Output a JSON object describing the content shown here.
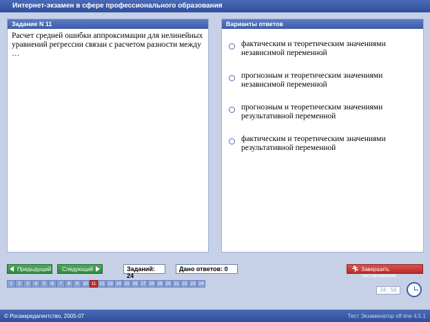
{
  "header": {
    "title": "Интернет-экзамен в сфере профессионального образования"
  },
  "question": {
    "heading": "Задание N 11",
    "text": "Расчет средней ошибки аппроксимации для нелинейных уравнений регрессии связан с расчетом разности между …"
  },
  "answers": {
    "heading": "Варианты ответов",
    "options": [
      "фактическим и теоретическим значениями независимой переменной",
      "прогнозным и теоретическим значениями независимой переменной",
      "прогнозным и теоретическим значениями результативной переменной",
      "фактическим и теоретическим значениями результативной переменной"
    ]
  },
  "nav": {
    "prev_label": "Предыдущий",
    "next_label": "Следующий"
  },
  "counters": {
    "tasks": "Заданий: 24",
    "answered": "Дано ответов: 0"
  },
  "finish_label": "Завершить тестирование",
  "pages": [
    "1",
    "2",
    "3",
    "4",
    "5",
    "6",
    "7",
    "8",
    "9",
    "10",
    "11",
    "12",
    "13",
    "14",
    "15",
    "16",
    "17",
    "18",
    "19",
    "20",
    "21",
    "22",
    "23",
    "24"
  ],
  "current_page": "11",
  "timer": "34 : 56",
  "footer": {
    "copyright": "© Росаккредагентство, 2005-07",
    "version": "Тест Экзаменатор off-line 4.5.1"
  },
  "colors": {
    "accent": "#3c5ba8",
    "current_page": "#c0312b",
    "nav_button": "#2f8a3d",
    "finish_button": "#b52f2b"
  }
}
